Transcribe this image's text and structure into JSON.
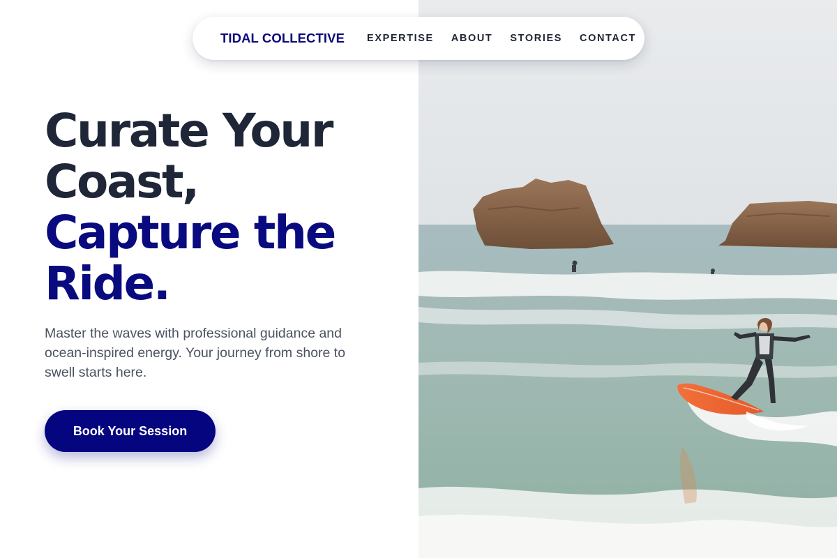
{
  "nav": {
    "brand": "TIDAL COLLECTIVE",
    "links": [
      {
        "label": "EXPERTISE"
      },
      {
        "label": "ABOUT"
      },
      {
        "label": "STORIES"
      },
      {
        "label": "CONTACT"
      }
    ]
  },
  "hero": {
    "headline_line1": "Curate Your",
    "headline_line2": "Coast,",
    "headline_line3": "Capture the",
    "headline_line4": "Ride.",
    "subtext": "Master the waves with professional guidance and ocean-inspired energy. Your journey from shore to swell starts here.",
    "cta_label": "Book Your Session"
  },
  "colors": {
    "brand_navy": "#0a0a80",
    "headline_dark": "#1e2638",
    "body_text": "#4b5262",
    "surfboard": "#ef6a35"
  },
  "image": {
    "icon": "surfer-photo"
  }
}
